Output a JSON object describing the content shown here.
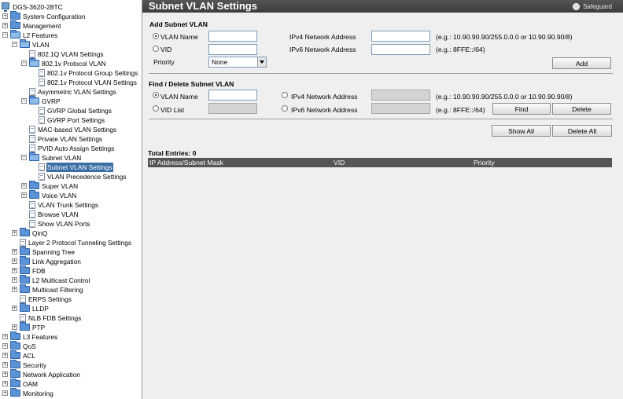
{
  "tree": {
    "items": [
      {
        "label": "DGS-3620-28TC",
        "kind": "device",
        "indent": 0,
        "toggle": ""
      },
      {
        "label": "System Configuration",
        "kind": "folder",
        "indent": 1,
        "toggle": "+"
      },
      {
        "label": "Management",
        "kind": "folder",
        "indent": 1,
        "toggle": "+"
      },
      {
        "label": "L2 Features",
        "kind": "folder-open",
        "indent": 1,
        "toggle": "-"
      },
      {
        "label": "VLAN",
        "kind": "folder-open",
        "indent": 2,
        "toggle": "-"
      },
      {
        "label": "802.1Q VLAN Settings",
        "kind": "doc",
        "indent": 3,
        "toggle": ""
      },
      {
        "label": "802.1v Protocol VLAN",
        "kind": "folder-open",
        "indent": 3,
        "toggle": "-"
      },
      {
        "label": "802.1v Protocol Group Settings",
        "kind": "doc",
        "indent": 4,
        "toggle": ""
      },
      {
        "label": "802.1v Protocol VLAN Settings",
        "kind": "doc",
        "indent": 4,
        "toggle": ""
      },
      {
        "label": "Asymmetric VLAN Settings",
        "kind": "doc",
        "indent": 3,
        "toggle": ""
      },
      {
        "label": "GVRP",
        "kind": "folder-open",
        "indent": 3,
        "toggle": "-"
      },
      {
        "label": "GVRP Global Settings",
        "kind": "doc",
        "indent": 4,
        "toggle": ""
      },
      {
        "label": "GVRP Port Settings",
        "kind": "doc",
        "indent": 4,
        "toggle": ""
      },
      {
        "label": "MAC-based VLAN Settings",
        "kind": "doc",
        "indent": 3,
        "toggle": ""
      },
      {
        "label": "Private VLAN Settings",
        "kind": "doc",
        "indent": 3,
        "toggle": ""
      },
      {
        "label": "PVID Auto Assign Settings",
        "kind": "doc",
        "indent": 3,
        "toggle": ""
      },
      {
        "label": "Subnet VLAN",
        "kind": "folder-open",
        "indent": 3,
        "toggle": "-"
      },
      {
        "label": "Subnet VLAN Settings",
        "kind": "doc",
        "indent": 4,
        "toggle": "",
        "selected": true
      },
      {
        "label": "VLAN Precedence Settings",
        "kind": "doc",
        "indent": 4,
        "toggle": ""
      },
      {
        "label": "Super VLAN",
        "kind": "folder",
        "indent": 3,
        "toggle": "+"
      },
      {
        "label": "Voice VLAN",
        "kind": "folder",
        "indent": 3,
        "toggle": "+"
      },
      {
        "label": "VLAN Trunk Settings",
        "kind": "doc",
        "indent": 3,
        "toggle": ""
      },
      {
        "label": "Browse VLAN",
        "kind": "doc",
        "indent": 3,
        "toggle": ""
      },
      {
        "label": "Show VLAN Ports",
        "kind": "doc",
        "indent": 3,
        "toggle": ""
      },
      {
        "label": "QinQ",
        "kind": "folder",
        "indent": 2,
        "toggle": "+"
      },
      {
        "label": "Layer 2 Protocol Tunneling Settings",
        "kind": "doc",
        "indent": 2,
        "toggle": ""
      },
      {
        "label": "Spanning Tree",
        "kind": "folder",
        "indent": 2,
        "toggle": "+"
      },
      {
        "label": "Link Aggregation",
        "kind": "folder",
        "indent": 2,
        "toggle": "+"
      },
      {
        "label": "FDB",
        "kind": "folder",
        "indent": 2,
        "toggle": "+"
      },
      {
        "label": "L2 Multicast Control",
        "kind": "folder",
        "indent": 2,
        "toggle": "+"
      },
      {
        "label": "Multicast Filtering",
        "kind": "folder",
        "indent": 2,
        "toggle": "+"
      },
      {
        "label": "ERPS Settings",
        "kind": "doc",
        "indent": 2,
        "toggle": ""
      },
      {
        "label": "LLDP",
        "kind": "folder",
        "indent": 2,
        "toggle": "+"
      },
      {
        "label": "NLB FDB Settings",
        "kind": "doc",
        "indent": 2,
        "toggle": ""
      },
      {
        "label": "PTP",
        "kind": "folder",
        "indent": 2,
        "toggle": "+"
      },
      {
        "label": "L3 Features",
        "kind": "folder",
        "indent": 1,
        "toggle": "+"
      },
      {
        "label": "QoS",
        "kind": "folder",
        "indent": 1,
        "toggle": "+"
      },
      {
        "label": "ACL",
        "kind": "folder",
        "indent": 1,
        "toggle": "+"
      },
      {
        "label": "Security",
        "kind": "folder",
        "indent": 1,
        "toggle": "+"
      },
      {
        "label": "Network Application",
        "kind": "folder",
        "indent": 1,
        "toggle": "+"
      },
      {
        "label": "OAM",
        "kind": "folder",
        "indent": 1,
        "toggle": "+"
      },
      {
        "label": "Monitoring",
        "kind": "folder",
        "indent": 1,
        "toggle": "+"
      }
    ]
  },
  "header": {
    "title": "Subnet VLAN Settings",
    "brand": "Safeguard"
  },
  "add_section": {
    "title": "Add Subnet VLAN",
    "vlan_name_label": "VLAN Name",
    "vlan_name_value": "",
    "vid_label": "VID",
    "vid_value": "",
    "priority_label": "Priority",
    "priority_value": "None",
    "ipv4_label": "IPv4 Network Address",
    "ipv4_value": "",
    "ipv4_hint": "(e.g.: 10.90.90.90/255.0.0.0 or 10.90.90.90/8)",
    "ipv6_label": "IPv6 Network Address",
    "ipv6_value": "",
    "ipv6_hint": "(e.g.: 8FFE::/64)",
    "add_label": "Add"
  },
  "find_section": {
    "title": "Find / Delete Subnet VLAN",
    "vlan_name_label": "VLAN Name",
    "vlan_name_value": "",
    "vid_list_label": "VID List",
    "vid_list_value": "",
    "ipv4_label": "IPv4 Network Address",
    "ipv4_value": "",
    "ipv4_hint": "(e.g.: 10.90.90.90/255.0.0.0 or 10.90.90.90/8)",
    "ipv6_label": "IPv6 Network Address",
    "ipv6_value": "",
    "ipv6_hint": "(e.g.: 8FFE::/64)",
    "find_label": "Find",
    "delete_label": "Delete"
  },
  "actions": {
    "show_all_label": "Show All",
    "delete_all_label": "Delete All"
  },
  "results": {
    "total_entries": "Total Entries: 0",
    "columns": [
      "IP Address/Subnet Mask",
      "VID",
      "Priority"
    ]
  },
  "colors": {
    "selected": "#3a6ea5",
    "title_bar": "#3c3c3c",
    "content_bg": "#efefef"
  }
}
